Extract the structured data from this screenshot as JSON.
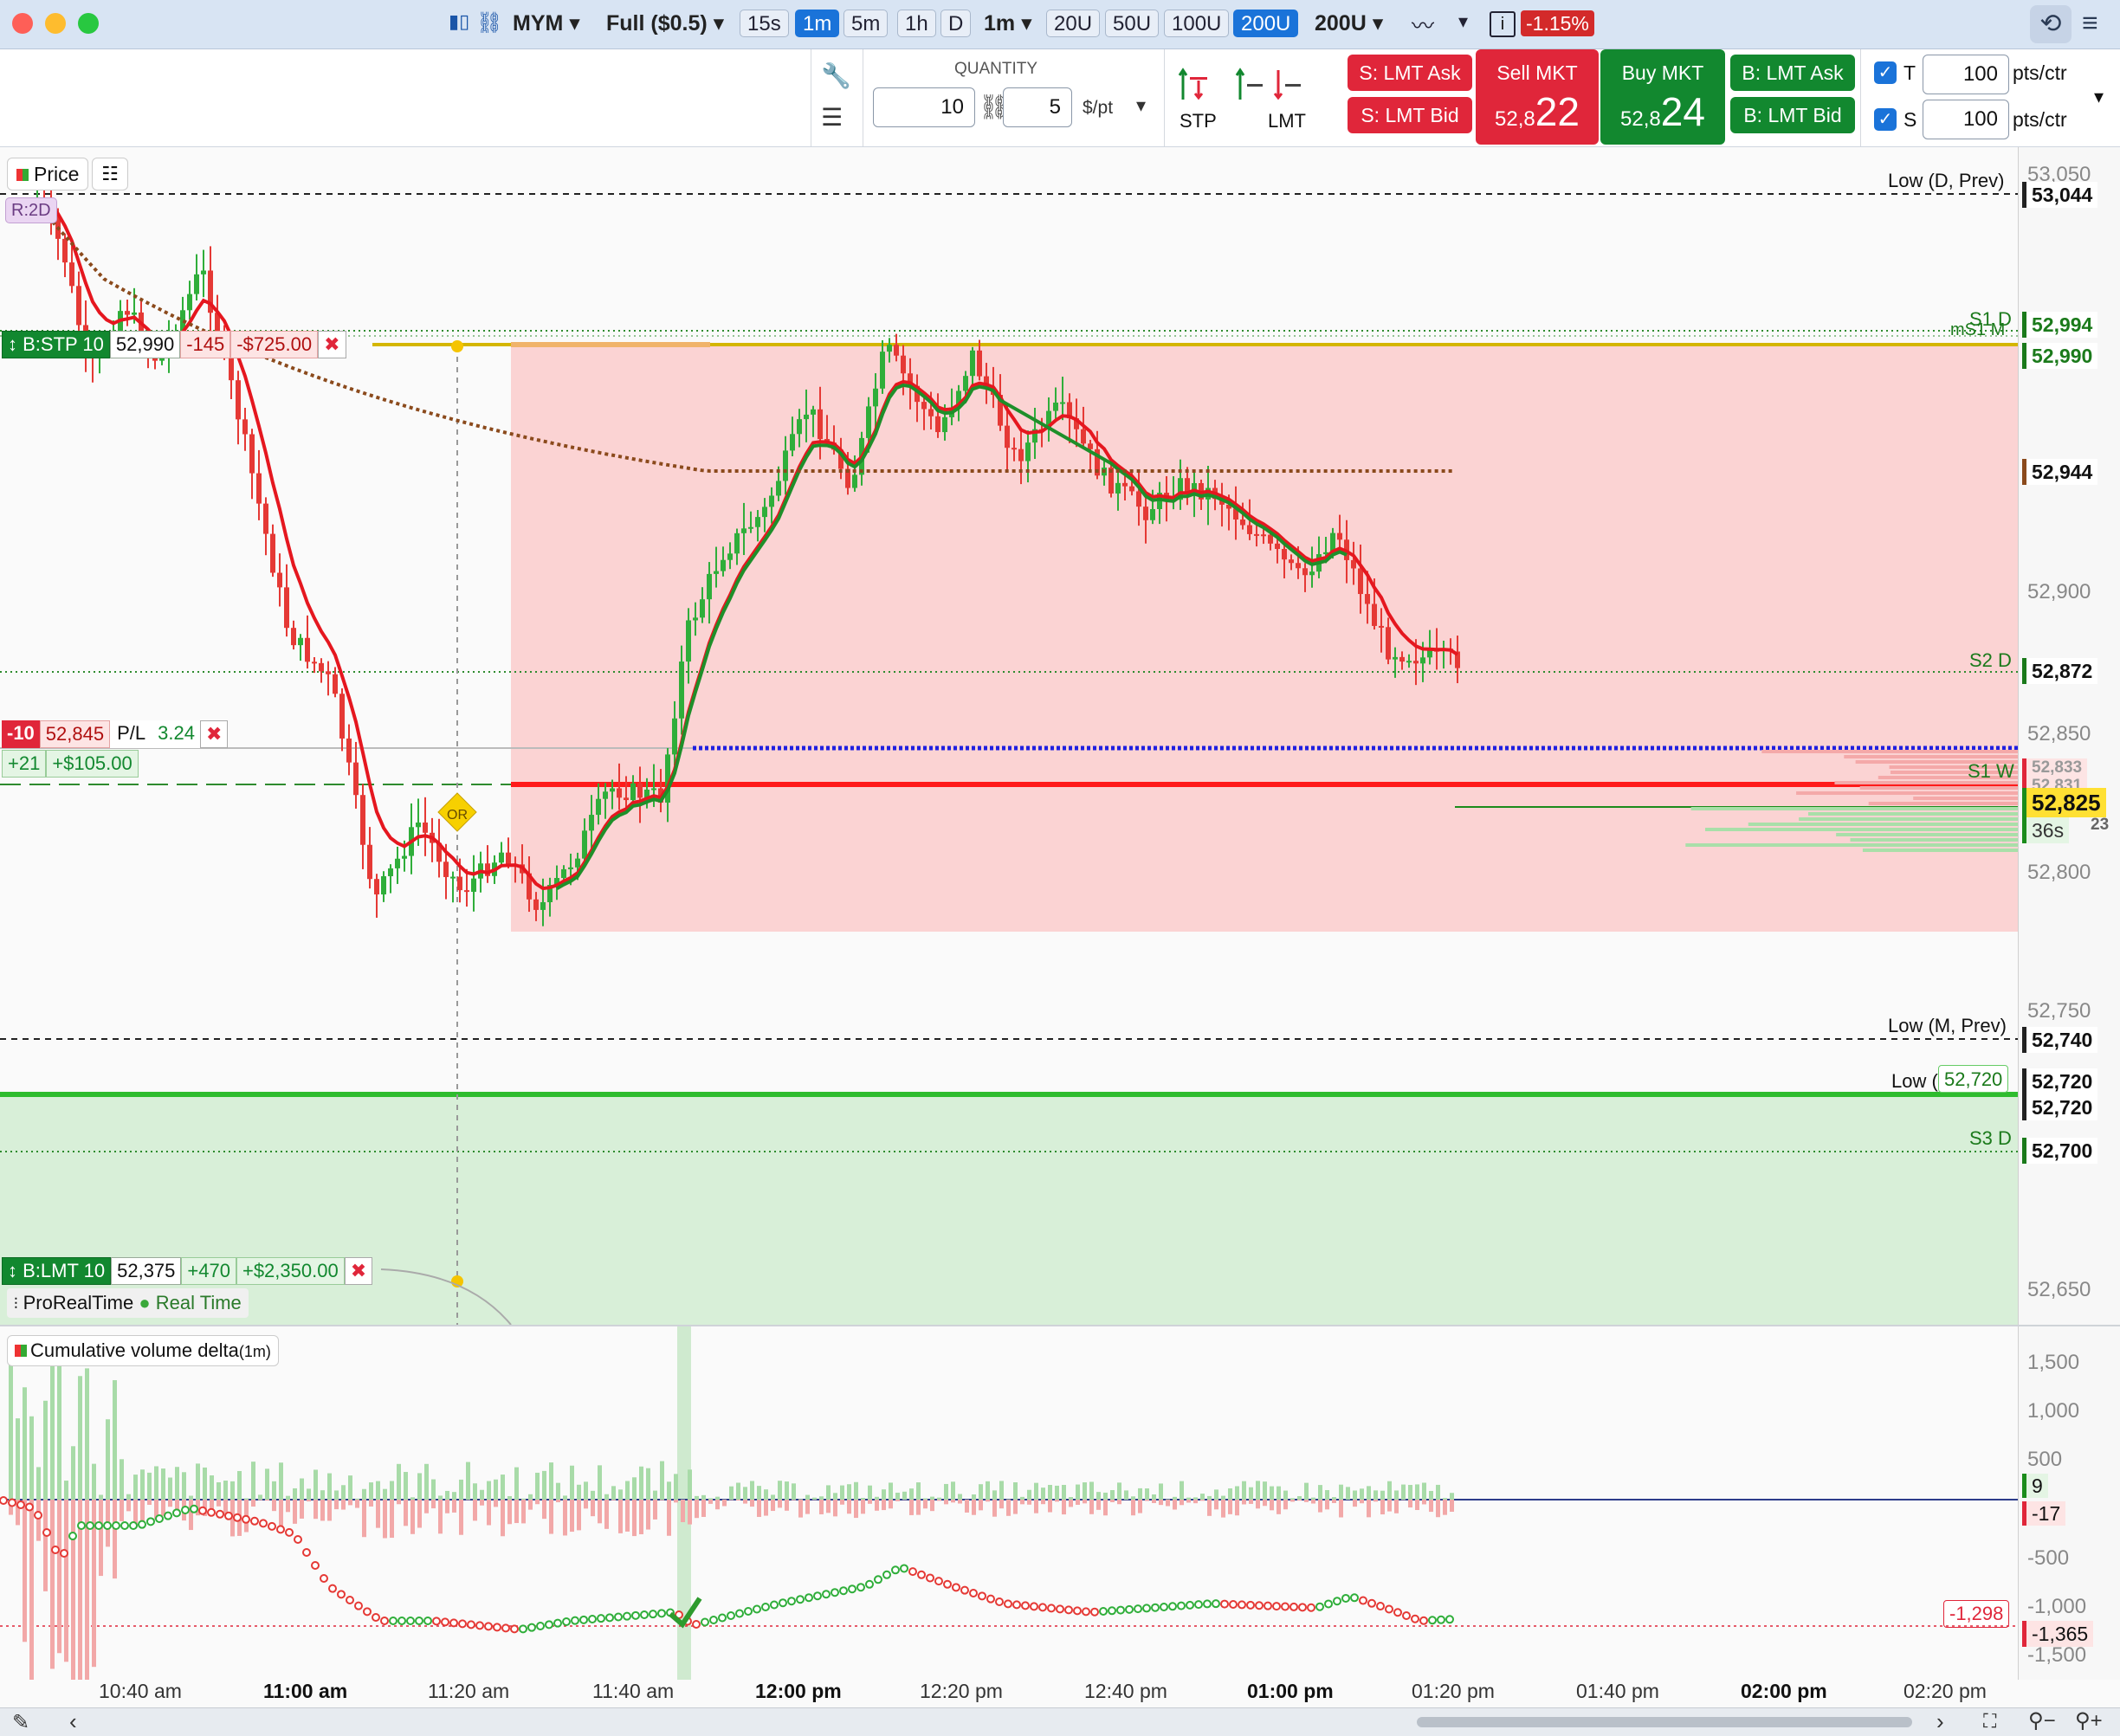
{
  "titlebar": {
    "symbol": "MYM",
    "account": "Full ($0.5)",
    "timeframes": [
      "15s",
      "1m",
      "5m",
      "1h",
      "D"
    ],
    "active_timeframe": "1m",
    "tf_select": "1m",
    "volume_bars": [
      "20U",
      "50U",
      "100U",
      "200U"
    ],
    "active_volume_bar": "200U",
    "vol_select": "200U",
    "change": "-1.15%",
    "info": "i"
  },
  "toolbar": {
    "quantity_label": "QUANTITY",
    "quantity": "10",
    "quantity2": "5",
    "per_pt": "$/pt",
    "stp_label": "STP",
    "lmt_label": "LMT",
    "sell_ask": "S: LMT Ask",
    "sell_bid": "S: LMT Bid",
    "sell_mkt": "Sell MKT",
    "sell_price_small": "52,8",
    "sell_price_big": "22",
    "buy_mkt": "Buy MKT",
    "buy_price_small": "52,8",
    "buy_price_big": "24",
    "buy_ask": "B: LMT Ask",
    "buy_bid": "B: LMT Bid",
    "t_label": "T",
    "t_value": "100",
    "s_label": "S",
    "s_value": "100",
    "pts_ctr": "pts/ctr"
  },
  "chart": {
    "price_button": "Price",
    "range_badge": "R:2D",
    "stop_order": {
      "label": "B:STP 10",
      "price": "52,990",
      "points": "-145",
      "pnl": "-$725.00"
    },
    "position": {
      "qty": "-10",
      "price": "52,845",
      "pl_label": "P/L",
      "pl_value": "3.24",
      "pts": "+21",
      "usd": "+$105.00"
    },
    "limit_order": {
      "label": "B:LMT 10",
      "price": "52,375",
      "points": "+470",
      "pnl": "+$2,350.00"
    },
    "or_badge": "OR",
    "source": "ProRealTime",
    "realtime": "Real Time",
    "level_labels": {
      "low_d_prev": "Low (D, Prev)",
      "s1d": "S1 D",
      "ms1m": "mS1 M",
      "s2d": "S2 D",
      "s1w": "S1 W",
      "low_m_prev": "Low (M, Prev)",
      "low_open": "Low (",
      "low_chip": "52,720",
      "s3d": "S3 D"
    },
    "axis_ticks": [
      "53,050",
      "52,900",
      "52,850",
      "52,800",
      "52,750",
      "52,650"
    ],
    "axis_tags": {
      "t53044": "53,044",
      "t52994": "52,994",
      "t52990": "52,990",
      "t52944": "52,944",
      "t52872": "52,872",
      "t52833": "52,833",
      "t52831": "52,831",
      "last": "52,825",
      "t23": "23",
      "countdown": "36s",
      "t52740": "52,740",
      "t52720a": "52,720",
      "t52720b": "52,720",
      "t52700": "52,700"
    }
  },
  "cvd": {
    "title": "Cumulative volume delta",
    "interval": "(1m)",
    "axis_ticks": [
      "1,500",
      "1,000",
      "500",
      "-500",
      "-1,000",
      "-1,500"
    ],
    "tags": {
      "pos": "9",
      "neg": "-17",
      "cvd_last": "-1,298",
      "cvd_now": "-1,365"
    }
  },
  "time_axis": [
    "10:40 am",
    "11:00 am",
    "11:20 am",
    "11:40 am",
    "12:00 pm",
    "12:20 pm",
    "12:40 pm",
    "01:00 pm",
    "01:20 pm",
    "01:40 pm",
    "02:00 pm",
    "02:20 pm"
  ],
  "colors": {
    "sell": "#e0263a",
    "buy": "#12882f",
    "stop_zone": "#fbd3d3",
    "target_zone": "#d8efd8",
    "accent": "#1a73d9"
  }
}
